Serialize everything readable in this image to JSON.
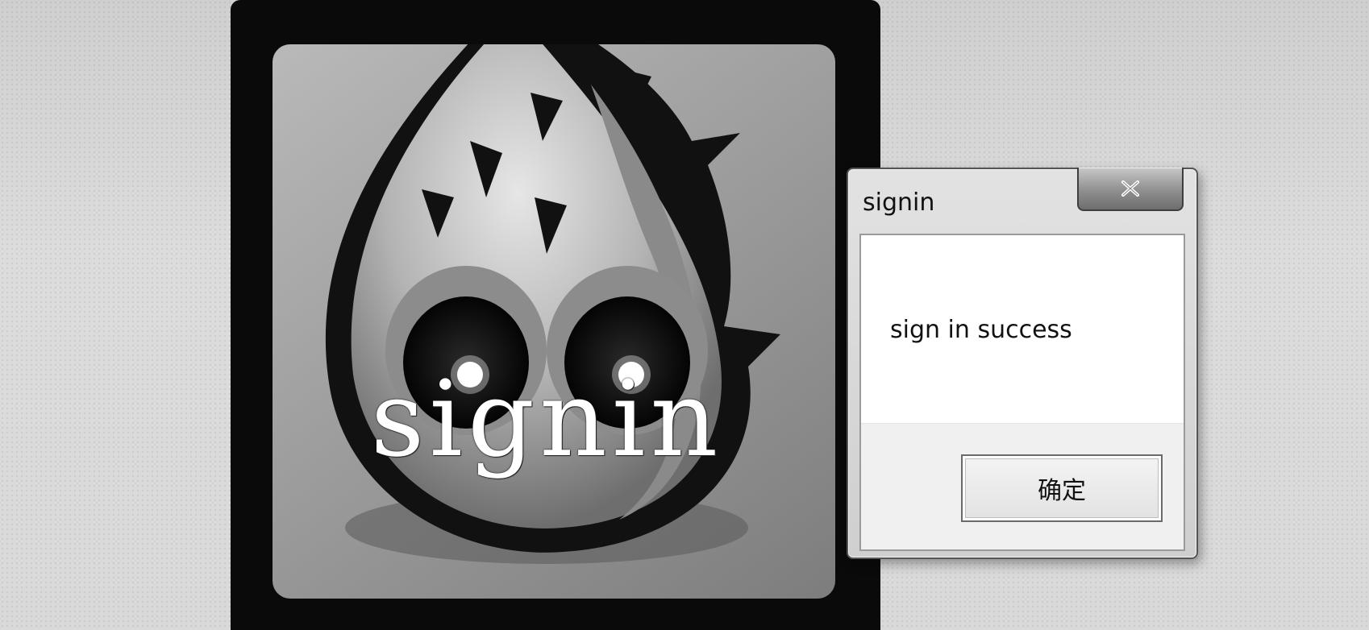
{
  "game": {
    "title_text": "signin"
  },
  "dialog": {
    "title": "signin",
    "close_icon": "close-icon",
    "message": "sign in success",
    "ok_label": "确定"
  }
}
